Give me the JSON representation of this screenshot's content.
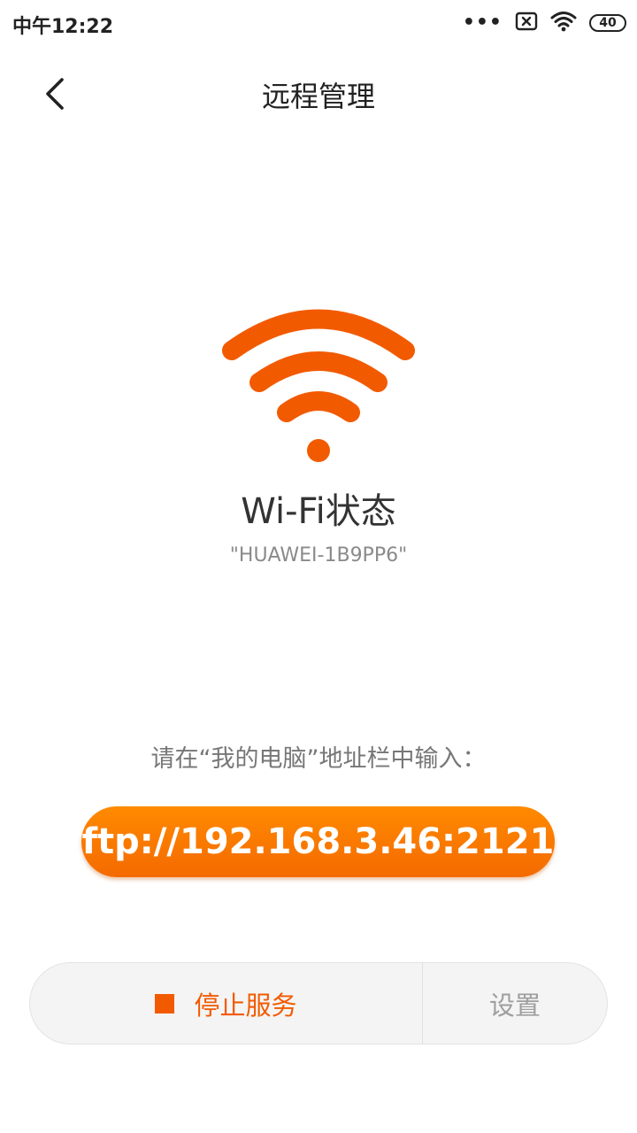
{
  "status_bar": {
    "time": "中午12:22",
    "dots": "•••",
    "battery": "40",
    "icons": [
      "more-dots-icon",
      "sim-blocked-icon",
      "wifi-signal-icon",
      "battery-icon"
    ]
  },
  "header": {
    "title": "远程管理",
    "back_icon": "chevron-left-icon"
  },
  "wifi": {
    "icon": "wifi-icon",
    "icon_color": "#f25a00",
    "status_title": "Wi-Fi状态",
    "ssid": "\"HUAWEI-1B9PP6\""
  },
  "instruction": "请在“我的电脑”地址栏中输入：",
  "address": "ftp://192.168.3.46:2121",
  "actions": {
    "stop_label": "停止服务",
    "settings_label": "设置",
    "stop_color": "#f25a00"
  },
  "colors": {
    "accent": "#f25a00",
    "address_gradient_top": "#ff8a00",
    "address_gradient_bottom": "#f46a00"
  }
}
